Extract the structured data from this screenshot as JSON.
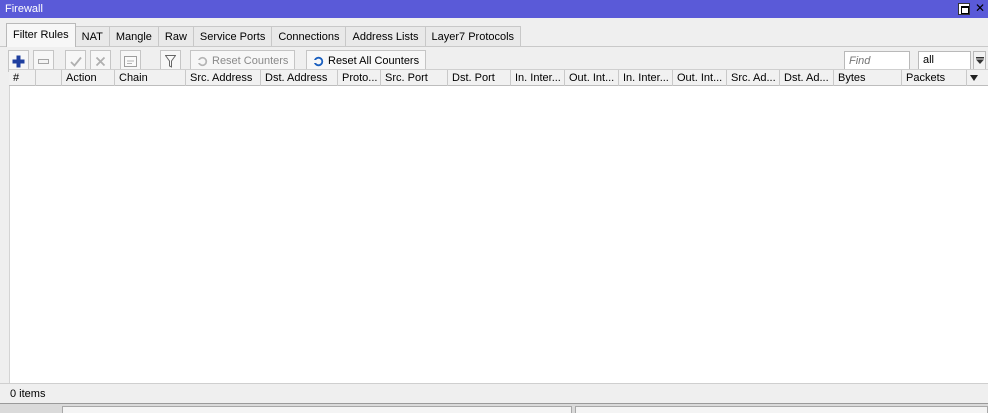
{
  "window": {
    "title": "Firewall"
  },
  "tabs": [
    "Filter Rules",
    "NAT",
    "Mangle",
    "Raw",
    "Service Ports",
    "Connections",
    "Address Lists",
    "Layer7 Protocols"
  ],
  "toolbar": {
    "reset_counters": "Reset Counters",
    "reset_all_counters": "Reset All Counters",
    "find_placeholder": "Find",
    "filter_value": "all"
  },
  "columns": [
    "#",
    "",
    "Action",
    "Chain",
    "Src. Address",
    "Dst. Address",
    "Proto...",
    "Src. Port",
    "Dst. Port",
    "In. Inter...",
    "Out. Int...",
    "In. Inter...",
    "Out. Int...",
    "Src. Ad...",
    "Dst. Ad...",
    "Bytes",
    "Packets"
  ],
  "status": {
    "items": "0 items"
  },
  "colors": {
    "titlebar": "#5a5ad8",
    "add_icon": "#1f3f9f",
    "reset_icon": "#1a5fbf"
  }
}
